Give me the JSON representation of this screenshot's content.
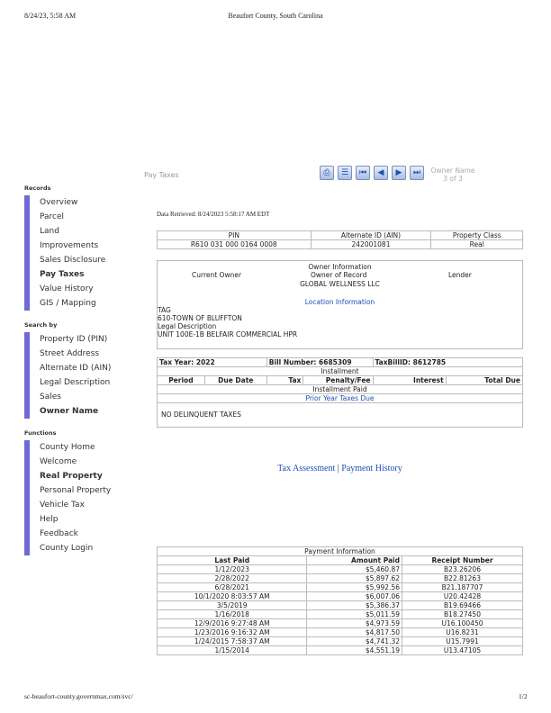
{
  "print_header": {
    "datetime": "8/24/23, 5:58 AM",
    "title": "Beaufort County, South Carolina"
  },
  "print_footer": {
    "url": "sc-beaufort-county.governmax.com/svc/",
    "page": "1/2"
  },
  "page_title": "Pay Taxes",
  "owner_nav": {
    "label": "Owner Name",
    "position": "3 of 3"
  },
  "sidebar": {
    "records_heading": "Records",
    "records": [
      "Overview",
      "Parcel",
      "Land",
      "Improvements",
      "Sales Disclosure",
      "Pay Taxes",
      "Value History",
      "GIS / Mapping"
    ],
    "search_heading": "Search by",
    "search": [
      "Property ID (PIN)",
      "Street Address",
      "Alternate ID (AIN)",
      "Legal Description",
      "Sales",
      "Owner Name"
    ],
    "functions_heading": "Functions",
    "functions": [
      "County Home",
      "Welcome",
      "Real Property",
      "Personal Property",
      "Vehicle Tax",
      "Help",
      "Feedback",
      "County Login"
    ]
  },
  "retrieved": "Data Retrieved: 8/24/2023 5:58:17 AM EDT",
  "pin_table": {
    "headers": [
      "PIN",
      "Alternate ID (AIN)",
      "Property Class"
    ],
    "row": [
      "R610 031 000 0164 0008",
      "242001081",
      "Real"
    ]
  },
  "owner_info": {
    "heading": "Owner Information",
    "current_owner": "Current Owner",
    "owner_of_record": "Owner of Record",
    "owner_name": "GLOBAL WELLNESS LLC",
    "lender": "Lender",
    "location_heading": "Location Information",
    "tag": "TAG",
    "district": "610-TOWN OF BLUFFTON",
    "legal_label": "Legal Description",
    "legal": "UNIT 100E-1B BELFAIR COMMERCIAL HPR"
  },
  "tax": {
    "year": "Tax Year: 2022",
    "bill": "Bill Number: 6685309",
    "billid": "TaxBillID: 8612785",
    "installment": "Installment",
    "headers": [
      "Period",
      "Due Date",
      "Tax",
      "Penalty/Fee",
      "Interest",
      "Total Due"
    ],
    "installment_paid": "Installment Paid",
    "prior_year": "Prior Year Taxes Due",
    "delinquent": "NO DELINQUENT TAXES"
  },
  "links": {
    "assessment": "Tax Assessment",
    "separator": "|",
    "history": "Payment History"
  },
  "payments": {
    "heading": "Payment Information",
    "headers": [
      "Last Paid",
      "Amount Paid",
      "Receipt Number"
    ],
    "rows": [
      [
        "1/12/2023",
        "$5,460.87",
        "B23.26206"
      ],
      [
        "2/28/2022",
        "$5,897.62",
        "B22.81263"
      ],
      [
        "6/28/2021",
        "$5,992.56",
        "B21.187707"
      ],
      [
        "10/1/2020 8:03:57 AM",
        "$6,007.06",
        "U20.42428"
      ],
      [
        "3/5/2019",
        "$5,386.37",
        "B19.69466"
      ],
      [
        "1/16/2018",
        "$5,011.59",
        "B18.27450"
      ],
      [
        "12/9/2016 9:27:48 AM",
        "$4,973.59",
        "U16.100450"
      ],
      [
        "1/23/2016 9:16:32 AM",
        "$4,817.50",
        "U16.8231"
      ],
      [
        "1/24/2015 7:58:37 AM",
        "$4,741.32",
        "U15.7991"
      ],
      [
        "1/15/2014",
        "$4,551.19",
        "U13.47105"
      ]
    ]
  },
  "icons": [
    "print-icon",
    "list-icon",
    "first-icon",
    "prev-icon",
    "next-icon",
    "last-icon"
  ]
}
